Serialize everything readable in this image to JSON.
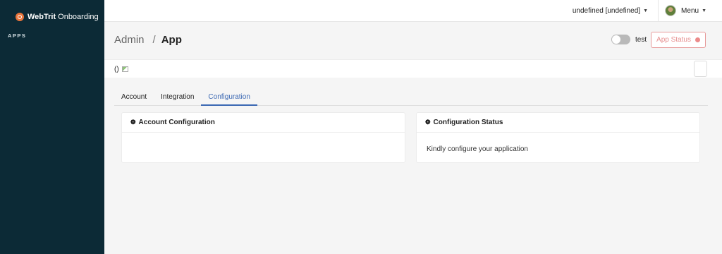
{
  "brand": {
    "name": "WebTrit",
    "subtitle": "Onboarding"
  },
  "sidebar": {
    "section_title": "APPS"
  },
  "header": {
    "user_label": "undefined [undefined]",
    "menu_label": "Menu"
  },
  "breadcrumb": {
    "parent": "Admin",
    "separator": "/",
    "current": "App"
  },
  "environment": {
    "toggle_label": "test",
    "toggle_on": false
  },
  "app_status": {
    "label": "App Status",
    "color": "#ec8a8a"
  },
  "info": {
    "text": "()"
  },
  "tabs": [
    {
      "label": "Account",
      "active": false
    },
    {
      "label": "Integration",
      "active": false
    },
    {
      "label": "Configuration",
      "active": true
    }
  ],
  "cards": {
    "account": {
      "title": "Account Configuration",
      "body": ""
    },
    "status": {
      "title": "Configuration Status",
      "body": "Kindly configure your application"
    }
  },
  "colors": {
    "sidebar_bg": "#0c2a36",
    "accent": "#3b68b3",
    "brand_orange": "#e8743b"
  }
}
